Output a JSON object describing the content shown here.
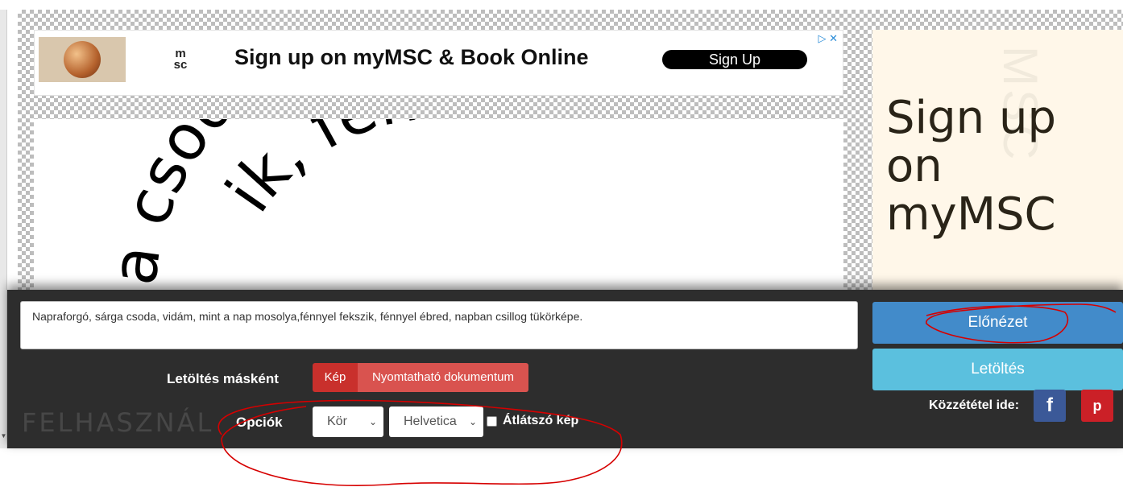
{
  "ad_banner": {
    "logo_text": "m sc",
    "headline": "Sign up on myMSC & Book Online",
    "signup_label": "Sign Up",
    "choices_icons": "▷ ✕"
  },
  "side_ad": {
    "text_line1": "Sign up",
    "text_line2": "on",
    "text_line3": "myMSC",
    "watermark": "MSC"
  },
  "preview": {
    "arc_text_outer": "a csoda, vidá",
    "arc_text_inner": "ik, fén",
    "fragment_left": "da"
  },
  "toolbar": {
    "text_value": "Napraforgó, sárga csoda, vidám, mint a nap mosolya,fénnyel fekszik, fénnyel ébred, napban csillog tükörképe.",
    "preview_button": "Előnézet",
    "download_button": "Letöltés",
    "download_as_label": "Letöltés másként",
    "format_image": "Kép",
    "format_printable": "Nyomtatható dokumentum",
    "options_label": "Opciók",
    "shape_value": "Kör",
    "font_value": "Helvetica",
    "transparent_label": "Átlátszó kép",
    "share_label": "Közzététel ide:",
    "watermark": "FELHASZNÁL",
    "facebook_glyph": "f",
    "pinterest_glyph": "p"
  },
  "colors": {
    "toolbar_bg": "#2d2d2d",
    "preview_btn": "#428bca",
    "download_btn": "#5bc0de",
    "format_active": "#c9302c",
    "format_other": "#d9534f",
    "facebook": "#3b5998",
    "pinterest": "#cb2027",
    "annotation": "#d60000"
  }
}
